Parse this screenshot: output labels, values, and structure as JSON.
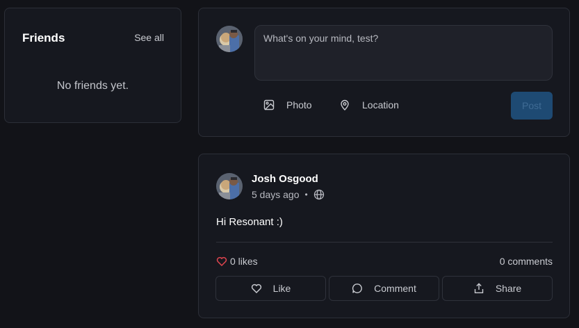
{
  "friends": {
    "title": "Friends",
    "see_all": "See all",
    "empty_text": "No friends yet."
  },
  "composer": {
    "placeholder": "What's on your mind, test?",
    "photo_label": "Photo",
    "location_label": "Location",
    "post_label": "Post"
  },
  "post": {
    "author": "Josh Osgood",
    "time": "5 days ago",
    "separator": "•",
    "visibility_icon": "globe-icon",
    "body": "Hi Resonant :)",
    "likes": "0 likes",
    "comments": "0 comments",
    "like_label": "Like",
    "comment_label": "Comment",
    "share_label": "Share"
  },
  "colors": {
    "background": "#121318",
    "card": "#16181f",
    "border": "#2c2f38",
    "primary_disabled": "#1e4a73",
    "heart": "#e0454f"
  }
}
